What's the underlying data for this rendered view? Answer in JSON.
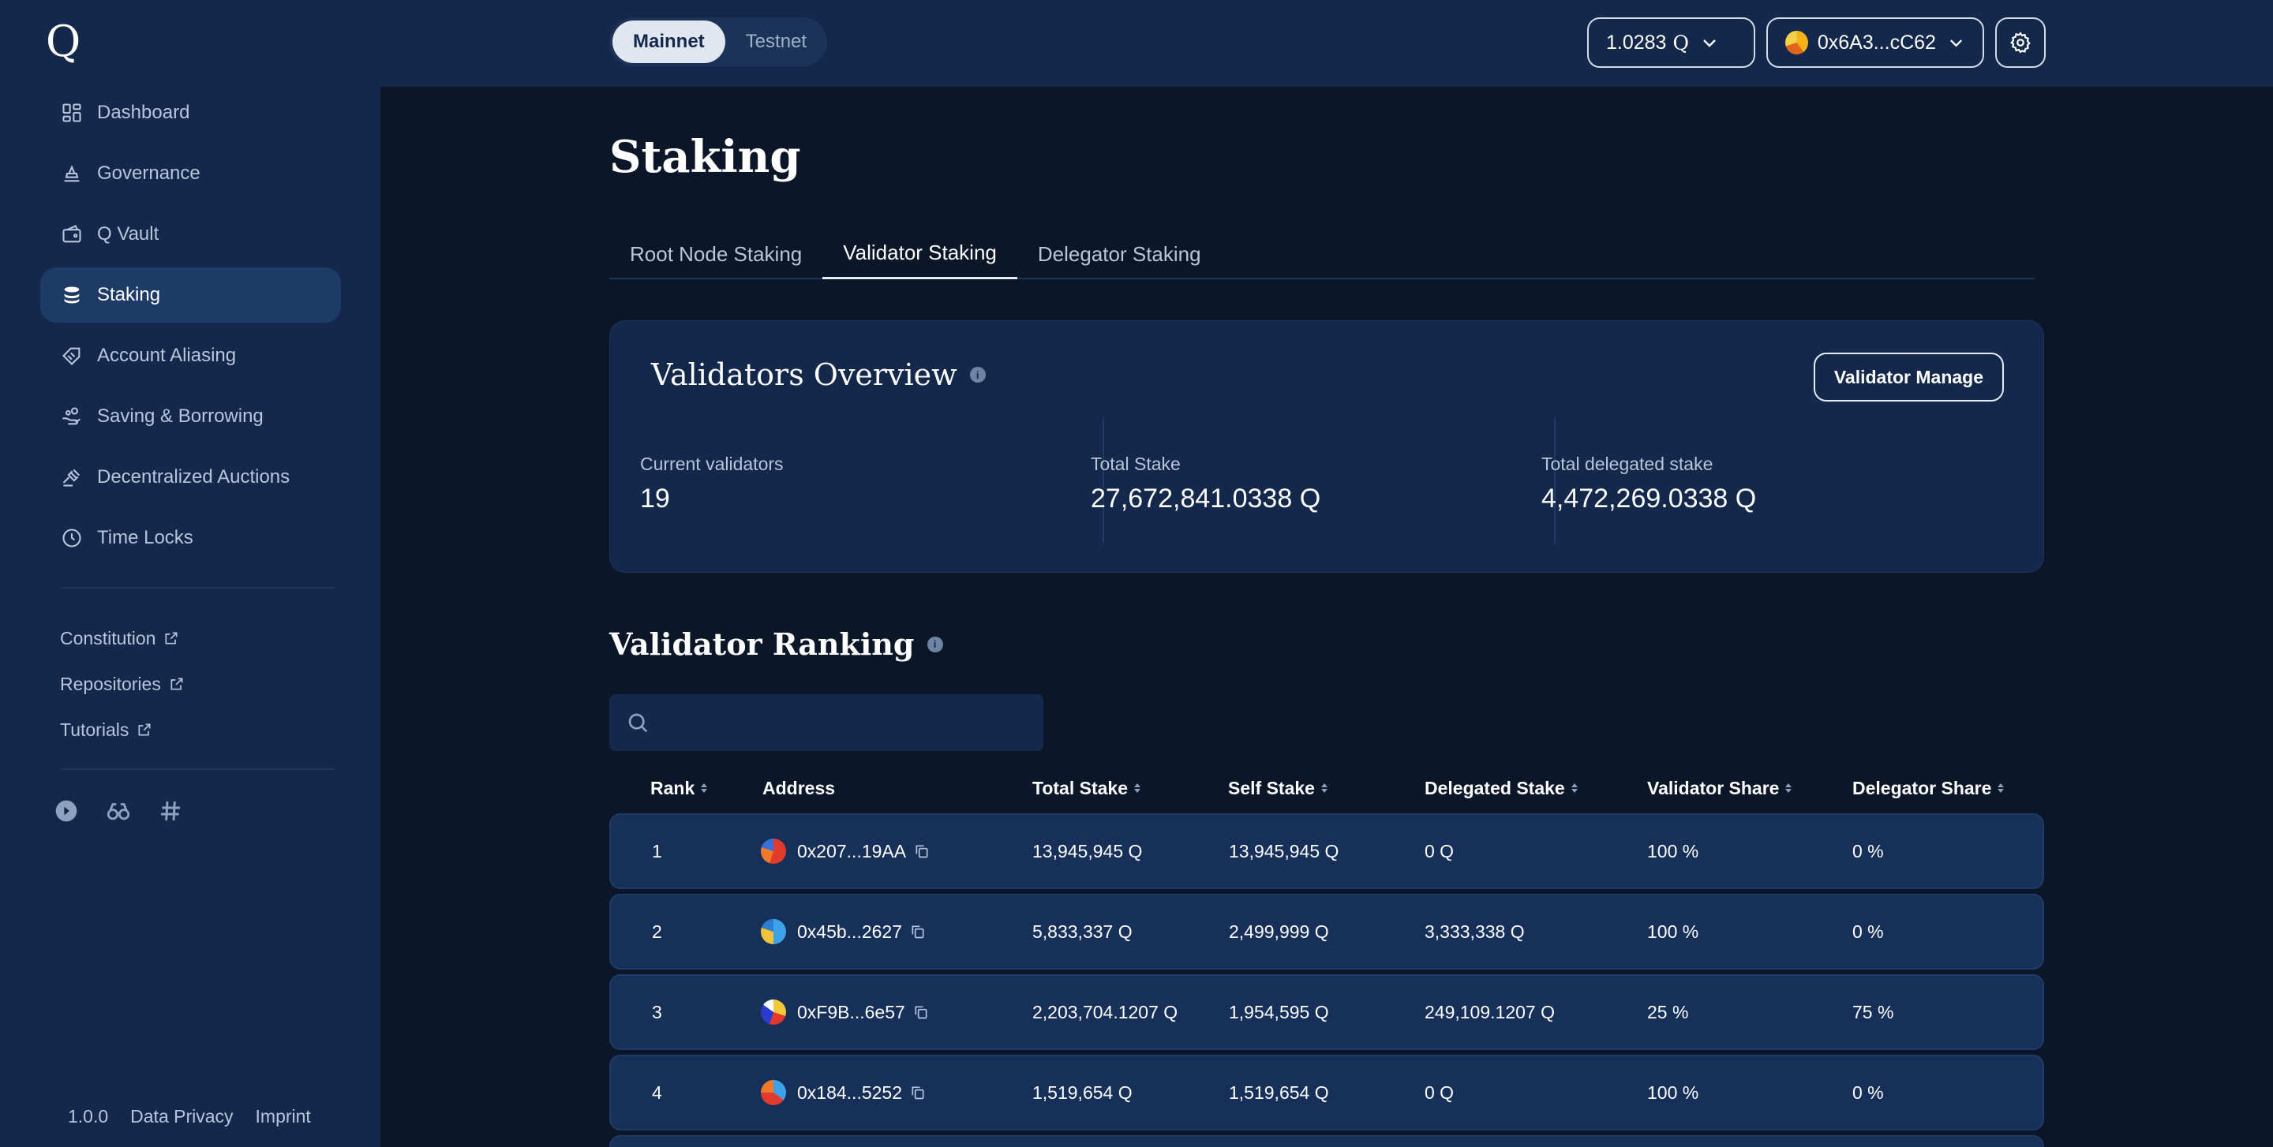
{
  "app": {
    "logo": "Q"
  },
  "sidebar": {
    "items": [
      {
        "label": "Dashboard",
        "icon": "dashboard-icon",
        "active": false
      },
      {
        "label": "Governance",
        "icon": "governance-icon",
        "active": false
      },
      {
        "label": "Q Vault",
        "icon": "wallet-icon",
        "active": false
      },
      {
        "label": "Staking",
        "icon": "staking-icon",
        "active": true
      },
      {
        "label": "Account Aliasing",
        "icon": "alias-icon",
        "active": false
      },
      {
        "label": "Saving & Borrowing",
        "icon": "saving-icon",
        "active": false
      },
      {
        "label": "Decentralized Auctions",
        "icon": "gavel-icon",
        "active": false
      },
      {
        "label": "Time Locks",
        "icon": "clock-icon",
        "active": false
      }
    ],
    "links": [
      {
        "label": "Constitution"
      },
      {
        "label": "Repositories"
      },
      {
        "label": "Tutorials"
      }
    ],
    "social_icons": [
      "q-social-icon",
      "binoculars-icon",
      "hash-icon"
    ],
    "footer": {
      "version": "1.0.0",
      "privacy": "Data Privacy",
      "imprint": "Imprint"
    }
  },
  "topbar": {
    "networks": {
      "mainnet": "Mainnet",
      "testnet": "Testnet",
      "selected": "Mainnet"
    },
    "balance": "1.0283",
    "balance_unit": "Q",
    "account": "0x6A3...cC62"
  },
  "page": {
    "title": "Staking",
    "tabs": [
      "Root Node Staking",
      "Validator Staking",
      "Delegator Staking"
    ],
    "active_tab": "Validator Staking"
  },
  "overview": {
    "title": "Validators Overview",
    "manage_button": "Validator Manage",
    "stats": [
      {
        "label": "Current validators",
        "value": "19"
      },
      {
        "label": "Total Stake",
        "value": "27,672,841.0338 Q"
      },
      {
        "label": "Total delegated stake",
        "value": "4,472,269.0338 Q"
      }
    ]
  },
  "ranking": {
    "title": "Validator Ranking",
    "search_placeholder": "",
    "columns": [
      "Rank",
      "Address",
      "Total Stake",
      "Self Stake",
      "Delegated Stake",
      "Validator Share",
      "Delegator Share"
    ],
    "rows": [
      {
        "rank": "1",
        "address": "0x207...19AA",
        "total": "13,945,945 Q",
        "self": "13,945,945 Q",
        "delegated": "0 Q",
        "vshare": "100 %",
        "dshare": "0 %"
      },
      {
        "rank": "2",
        "address": "0x45b...2627",
        "total": "5,833,337 Q",
        "self": "2,499,999 Q",
        "delegated": "3,333,338 Q",
        "vshare": "100 %",
        "dshare": "0 %"
      },
      {
        "rank": "3",
        "address": "0xF9B...6e57",
        "total": "2,203,704.1207 Q",
        "self": "1,954,595 Q",
        "delegated": "249,109.1207 Q",
        "vshare": "25 %",
        "dshare": "75 %"
      },
      {
        "rank": "4",
        "address": "0x184...5252",
        "total": "1,519,654 Q",
        "self": "1,519,654 Q",
        "delegated": "0 Q",
        "vshare": "100 %",
        "dshare": "0 %"
      }
    ]
  },
  "colors": {
    "sidebar": "#13284a",
    "background": "#0b1628",
    "active_nav": "#1e3a66",
    "row": "#16305a"
  }
}
